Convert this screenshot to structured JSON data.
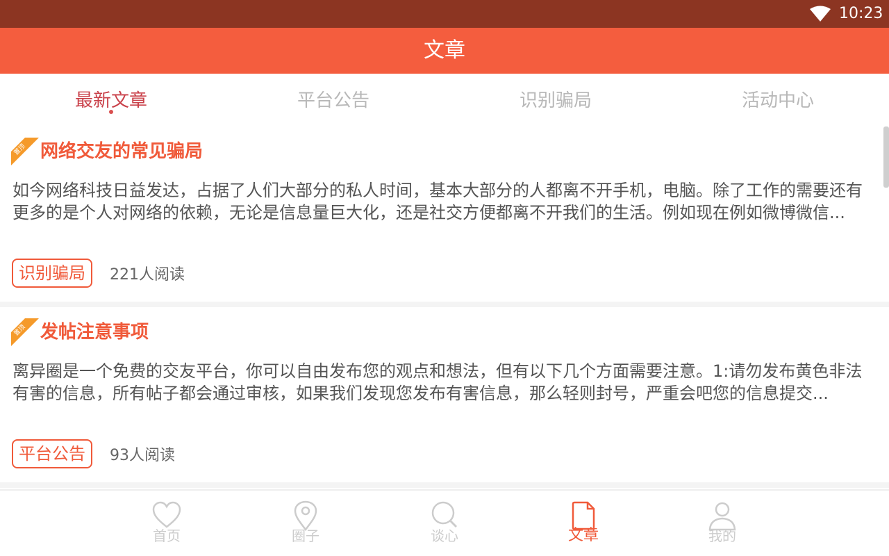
{
  "status_bar": {
    "time": "10:23"
  },
  "header": {
    "title": "文章"
  },
  "tabs": [
    {
      "label": "最新文章",
      "active": true
    },
    {
      "label": "平台公告",
      "active": false
    },
    {
      "label": "识别骗局",
      "active": false
    },
    {
      "label": "活动中心",
      "active": false
    }
  ],
  "articles": [
    {
      "badge": "置顶",
      "title": "网络交友的常见骗局",
      "excerpt": "如今网络科技日益发达，占据了人们大部分的私人时间，基本大部分的人都离不开手机，电脑。除了工作的需要还有更多的是个人对网络的依赖，无论是信息量巨大化，还是社交方便都离不开我们的生活。例如现在例如微博微信...",
      "tag": "识别骗局",
      "reads": "221人阅读"
    },
    {
      "badge": "置顶",
      "title": "发帖注意事项",
      "excerpt": "离异圈是一个免费的交友平台，你可以自由发布您的观点和想法，但有以下几个方面需要注意。1:请勿发布黄色非法有害的信息，所有帖子都会通过审核，如果我们发现您发布有害信息，那么轻则封号，严重会吧您的信息提交...",
      "tag": "平台公告",
      "reads": "93人阅读"
    }
  ],
  "bottom_nav": [
    {
      "label": "首页",
      "icon": "heart-icon",
      "active": false
    },
    {
      "label": "圈子",
      "icon": "location-pin-icon",
      "active": false
    },
    {
      "label": "谈心",
      "icon": "search-icon",
      "active": false
    },
    {
      "label": "文章",
      "icon": "document-icon",
      "active": true
    },
    {
      "label": "我的",
      "icon": "user-icon",
      "active": false
    }
  ],
  "colors": {
    "status_bar": "#8c3522",
    "header": "#f45d3e",
    "accent": "#f05a3a",
    "active_tab": "#c94049",
    "inactive": "#cccccc"
  }
}
